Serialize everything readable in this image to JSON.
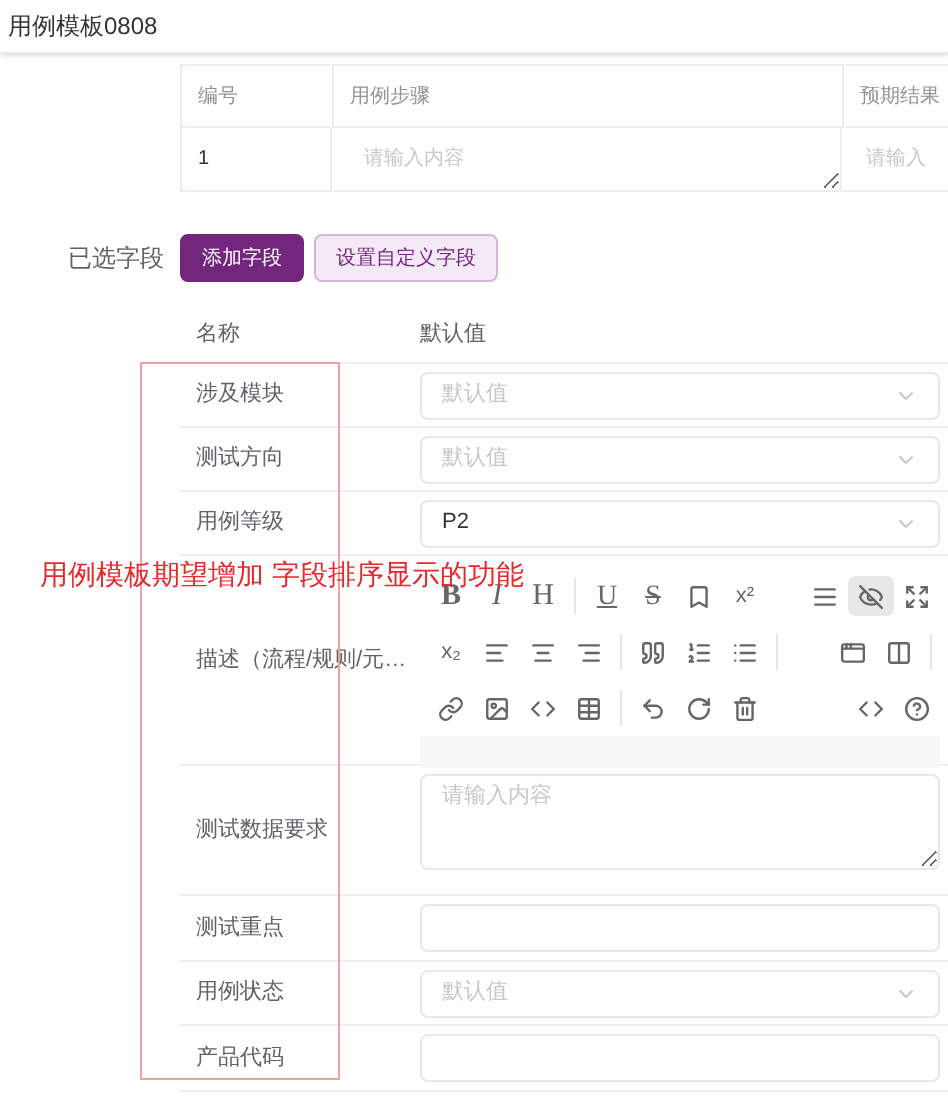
{
  "title": "用例模板0808",
  "steps_table": {
    "columns": [
      "编号",
      "用例步骤",
      "预期结果"
    ],
    "rows": [
      {
        "number": "1",
        "step_placeholder": "请输入内容",
        "result_placeholder": "请输入"
      }
    ]
  },
  "selected_fields": {
    "label": "已选字段",
    "buttons": [
      {
        "label": "添加字段",
        "kind": "primary"
      },
      {
        "label": "设置自定义字段",
        "kind": "plain"
      }
    ]
  },
  "fields_table": {
    "columns": [
      "名称",
      "默认值"
    ],
    "rows": [
      {
        "name": "涉及模块",
        "kind": "select",
        "placeholder": "默认值"
      },
      {
        "name": "测试方向",
        "kind": "select",
        "placeholder": "默认值"
      },
      {
        "name": "用例等级",
        "kind": "select",
        "value": "P2"
      },
      {
        "name": "描述（流程/规则/元…",
        "kind": "editor"
      },
      {
        "name": "测试数据要求",
        "kind": "textarea",
        "placeholder": "请输入内容"
      },
      {
        "name": "测试重点",
        "kind": "input"
      },
      {
        "name": "用例状态",
        "kind": "select",
        "placeholder": "默认值"
      },
      {
        "name": "产品代码",
        "kind": "input"
      }
    ]
  },
  "editor_toolbar": [
    [
      {
        "kind": "text",
        "label": "B",
        "active": false
      },
      {
        "kind": "text",
        "label": "I",
        "active": false
      },
      {
        "kind": "text",
        "label": "H",
        "active": false
      },
      {
        "kind": "divider"
      },
      {
        "kind": "text",
        "label": "U",
        "active": false
      },
      {
        "kind": "text",
        "label": "S",
        "active": false
      },
      {
        "kind": "icon",
        "active": false
      },
      {
        "kind": "text",
        "label": "x²",
        "active": false
      },
      {
        "kind": "spacer"
      },
      {
        "kind": "icon",
        "active": false
      },
      {
        "kind": "icon",
        "active": true
      },
      {
        "kind": "icon",
        "active": false
      }
    ],
    [
      {
        "kind": "text",
        "label": "x₂",
        "active": false
      },
      {
        "kind": "icon",
        "active": false
      },
      {
        "kind": "icon",
        "active": false
      },
      {
        "kind": "icon",
        "active": false
      },
      {
        "kind": "divider"
      },
      {
        "kind": "icon",
        "active": false
      },
      {
        "kind": "icon",
        "active": false
      },
      {
        "kind": "icon",
        "active": false
      },
      {
        "kind": "divider"
      },
      {
        "kind": "spacer"
      },
      {
        "kind": "icon",
        "active": false
      },
      {
        "kind": "icon",
        "active": false
      },
      {
        "kind": "divider"
      }
    ],
    [
      {
        "kind": "icon",
        "active": false
      },
      {
        "kind": "icon",
        "active": false
      },
      {
        "kind": "icon",
        "active": false
      },
      {
        "kind": "icon",
        "active": false
      },
      {
        "kind": "divider"
      },
      {
        "kind": "icon",
        "active": false
      },
      {
        "kind": "icon",
        "active": false
      },
      {
        "kind": "icon",
        "active": false
      },
      {
        "kind": "spacer"
      },
      {
        "kind": "icon",
        "active": false
      },
      {
        "kind": "icon",
        "active": false
      }
    ]
  ],
  "annotation": "用例模板期望增加 字段排序显示的功能"
}
